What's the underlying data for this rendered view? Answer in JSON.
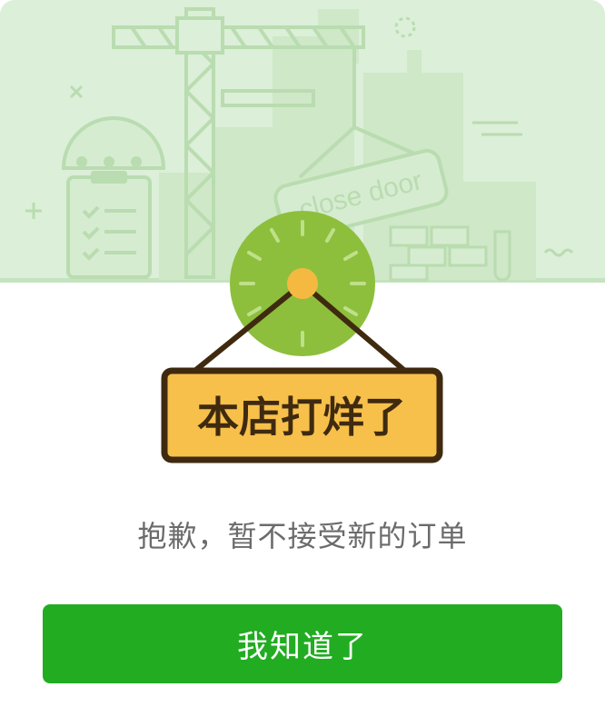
{
  "sign": {
    "text": "本店打烊了",
    "board_color": "#f7c04a",
    "border_color": "#3f2a10",
    "text_color": "#3f2a10"
  },
  "background_sign": {
    "text": "close door"
  },
  "clock": {
    "face_color": "#8dbf3c",
    "pin_color": "#f5b942"
  },
  "message": {
    "text": "抱歉，暂不接受新的订单"
  },
  "ok_button": {
    "label": "我知道了",
    "color": "#22ac22"
  },
  "colors": {
    "scene_background": "#dcefd8",
    "scene_line": "#b9dcb0",
    "message_text": "#6b6b6b"
  },
  "icons": [
    "crane-icon",
    "clipboard-icon",
    "hard-hat-icon",
    "clock-icon",
    "hanging-sign-icon"
  ]
}
